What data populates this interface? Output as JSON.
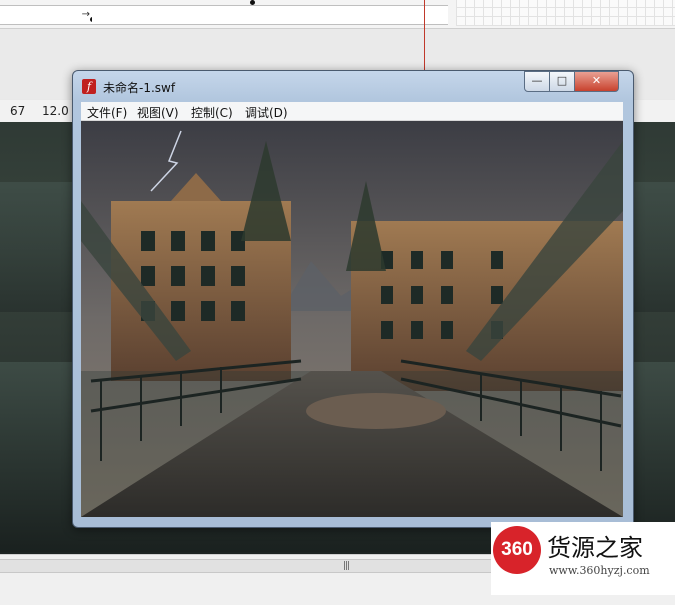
{
  "propbar": {
    "val1": "67",
    "val2": "12.0"
  },
  "window": {
    "title": "未命名-1.swf",
    "app_icon": "f",
    "buttons": {
      "minimize": "—",
      "maximize": "□",
      "close": "✕"
    },
    "menu": [
      "文件(F)",
      "视图(V)",
      "控制(C)",
      "调试(D)"
    ]
  },
  "watermark": {
    "logo_text": "360",
    "name": "货源之家",
    "url": "www.360hyzj.com"
  },
  "colors": {
    "accent_red": "#d8232a",
    "flash_red": "#c0201f",
    "playhead": "#c0392b"
  }
}
